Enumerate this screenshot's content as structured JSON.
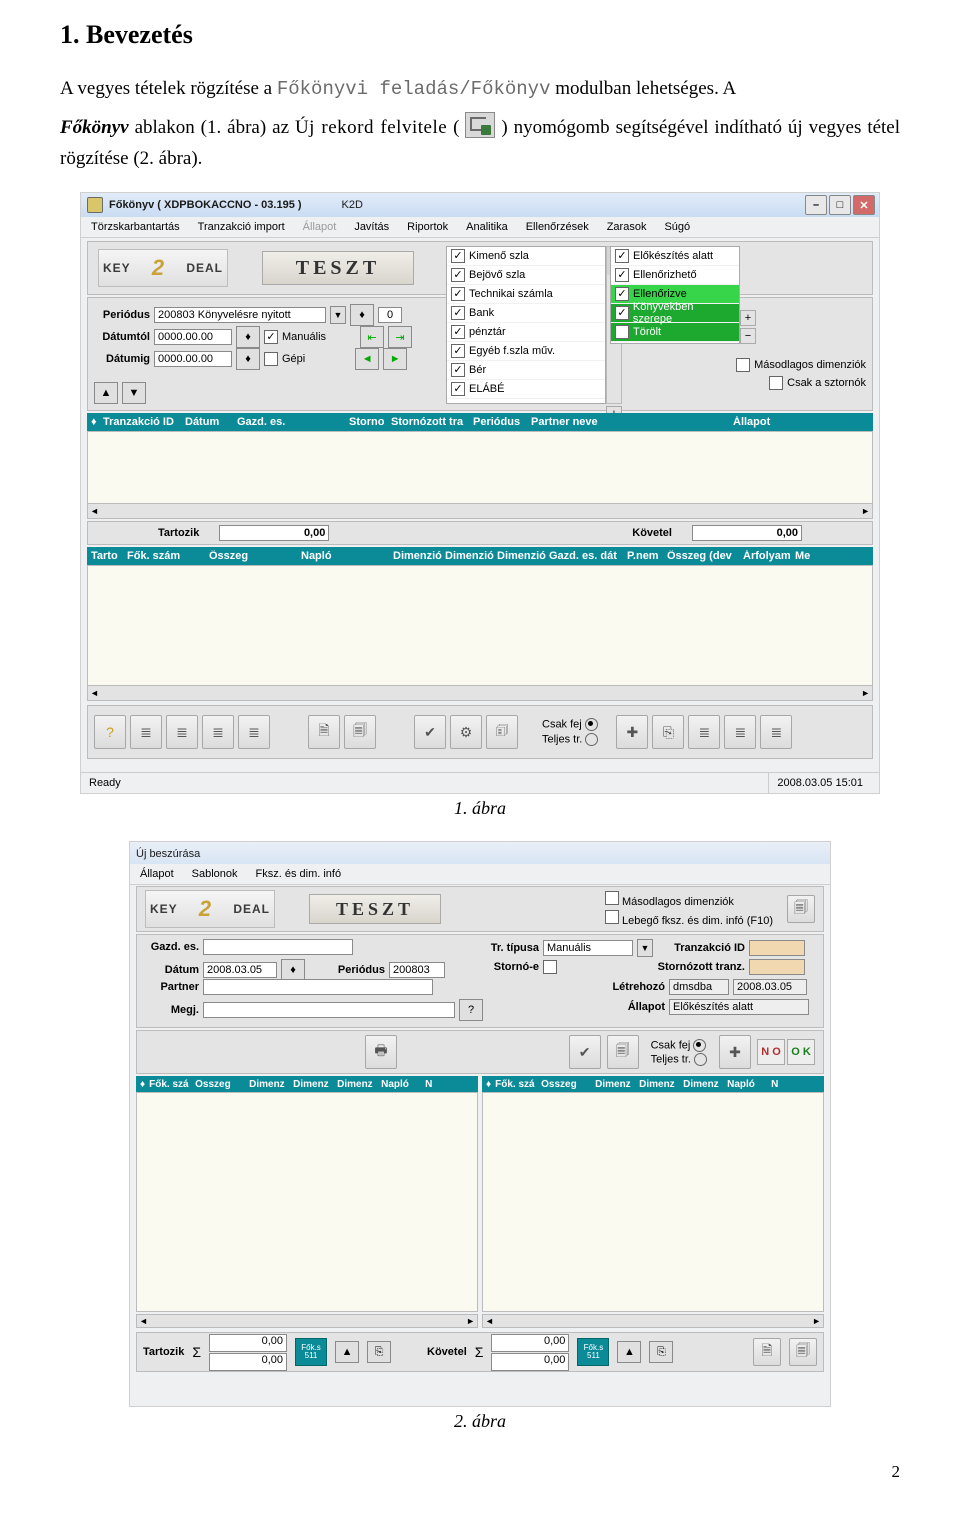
{
  "doc": {
    "heading": "1. Bevezetés",
    "p1a": "A  vegyes  tételek  rögzítése  a  ",
    "p1b": "Főkönyvi  feladás/Főkönyv",
    "p1c": "  modulban  lehetséges.  A",
    "p2a": "Főkönyv",
    "p2b": " ablakon (1. ábra) az ",
    "p2c": "Új rekord felvitele",
    "p2d": " (",
    "p2e": ") nyomógomb segítségével indítható új vegyes tétel rögzítése (2. ábra).",
    "caption1": "1. ábra",
    "caption2": "2. ábra",
    "pagenum": "2"
  },
  "win1": {
    "title": "Főkönyv ( XDPBOKACCNO - 03.195 )",
    "title_right": "K2D",
    "menu": [
      "Törzskarbantartás",
      "Tranzakció import",
      "Állapot",
      "Javítás",
      "Riportok",
      "Analitika",
      "Ellenőrzések",
      "Zarasok",
      "Súgó"
    ],
    "menu_disabled_idx": 2,
    "logo_left": "KEY",
    "logo_mid": "2",
    "logo_right": "DEAL",
    "teszt": "TESZT",
    "periodus_label": "Periódus",
    "periodus_val": "200803  Könyvelésre nyitott",
    "periodus_step": "0",
    "datumtol_label": "Dátumtól",
    "datumtol_val": "0000.00.00",
    "datumig_label": "Dátumig",
    "datumig_val": "0000.00.00",
    "manualis": "Manuális",
    "gepi": "Gépi",
    "check_left": [
      {
        "label": "Kimenő szla",
        "on": true
      },
      {
        "label": "Bejövő szla",
        "on": true
      },
      {
        "label": "Technikai számla",
        "on": true
      },
      {
        "label": "Bank",
        "on": true
      },
      {
        "label": "pénztár",
        "on": true
      },
      {
        "label": "Egyéb f.szla műv.",
        "on": true
      },
      {
        "label": "Bér",
        "on": true
      },
      {
        "label": "ELÁBÉ",
        "on": true
      }
    ],
    "check_right": [
      {
        "label": "Előkészítés alatt",
        "on": true,
        "hl": ""
      },
      {
        "label": "Ellenőrizhető",
        "on": true,
        "hl": ""
      },
      {
        "label": "Ellenőrizve",
        "on": true,
        "hl": "hl"
      },
      {
        "label": "Könyvekben szerepe",
        "on": true,
        "hl": "hl2"
      },
      {
        "label": "Törölt",
        "on": false,
        "hl": "hl2"
      }
    ],
    "masodlagos": "Másodlagos dimenziók",
    "csak_sztornok": "Csak a sztornók",
    "gridcols1": [
      "Tranzakció ID",
      "Dátum",
      "Gazd. es.",
      "Storno",
      "Stornózott tra",
      "Periódus",
      "Partner neve",
      "Állapot"
    ],
    "tartozik": "Tartozik",
    "tartozik_val": "0,00",
    "kovetel": "Követel",
    "kovetel_val": "0,00",
    "gridcols2": [
      "Tarto",
      "Fők. szám",
      "Összeg",
      "Napló",
      "Dimenzió",
      "Dimenzió",
      "Dimenzió",
      "Gazd. es. dát",
      "P.nem",
      "Összeg (dev",
      "Árfolyam",
      "Me"
    ],
    "radio_csakfej": "Csak fej",
    "radio_teljes": "Teljes tr.",
    "status": "Ready",
    "status_time": "2008.03.05 15:01"
  },
  "win2": {
    "title": "Új beszúrása",
    "menu": [
      "Állapot",
      "Sablonok",
      "Fksz. és dim. infó"
    ],
    "masodlagos": "Másodlagos dimenziók",
    "lebego": "Lebegő fksz. és dim. infó (F10)",
    "teszt": "TESZT",
    "gazd_label": "Gazd. es.",
    "datum_label": "Dátum",
    "datum_val": "2008.03.05",
    "periodus_label": "Periódus",
    "periodus_val": "200803",
    "partner_label": "Partner",
    "megj_label": "Megj.",
    "trtipus_label": "Tr. típusa",
    "trtipus_val": "Manuális",
    "storno_label": "Stornó-e",
    "tranzid_label": "Tranzakció ID",
    "sttranz_label": "Stornózott tranz.",
    "letrehozo_label": "Létrehozó",
    "letrehozo_val": "dmsdba",
    "letrehozo_date": "2008.03.05",
    "allapot_label": "Állapot",
    "allapot_val": "Előkészítés alatt",
    "radio_csakfej": "Csak fej",
    "radio_teljes": "Teljes tr.",
    "gridcols_l": [
      "Fők. szá",
      "Összeg",
      "Dimenz",
      "Dimenz",
      "Dimenz",
      "Napló",
      "N"
    ],
    "gridcols_r": [
      "Fők. szá",
      "Összeg",
      "Dimenz",
      "Dimenz",
      "Dimenz",
      "Napló",
      "N"
    ],
    "tartozik": "Tartozik",
    "kovetel": "Követel",
    "sigma": "Σ",
    "zero": "0,00",
    "badge_top": "Fők.s",
    "badge_bot": "511"
  }
}
